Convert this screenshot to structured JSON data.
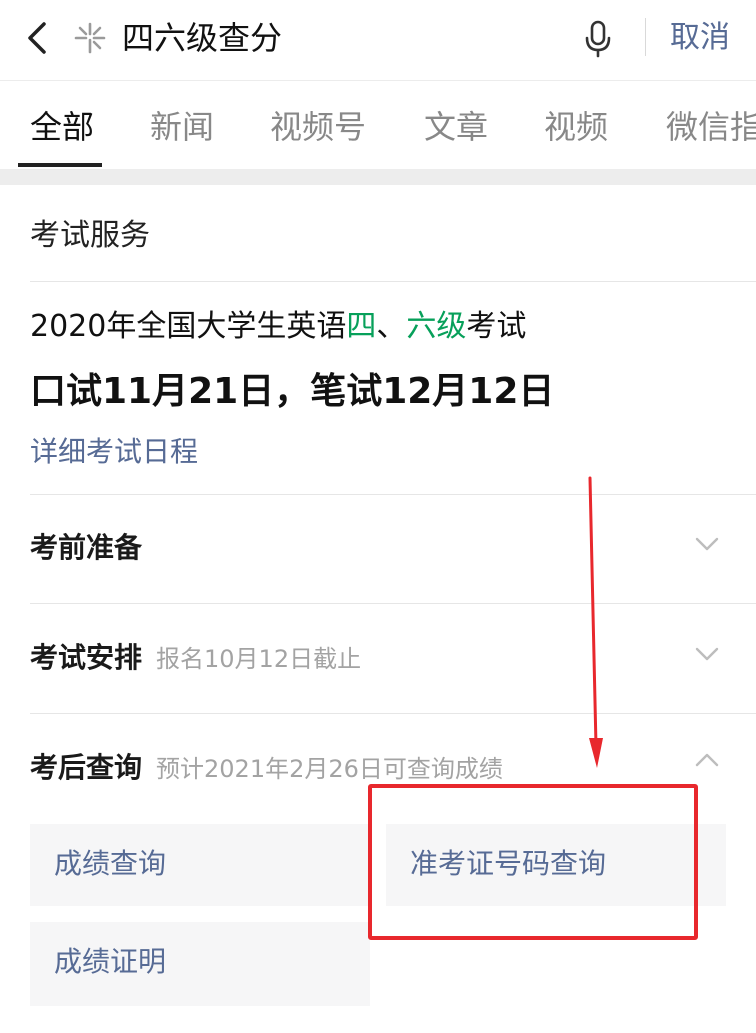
{
  "search": {
    "query": "四六级查分",
    "cancel_label": "取消",
    "icons": [
      "back-arrow-icon",
      "sparkle-icon",
      "microphone-icon"
    ]
  },
  "tabs": [
    "全部",
    "新闻",
    "视频号",
    "文章",
    "视频",
    "微信指"
  ],
  "active_tab": "全部",
  "card": {
    "section_title": "考试服务",
    "headline": {
      "prefix": "2020年全国大学生英语",
      "si": "四",
      "sep": "、",
      "liu": "六级",
      "suffix": "考试"
    },
    "date_line": "口试11月21日，笔试12月12日",
    "schedule_link": "详细考试日程",
    "rows": [
      {
        "title": "考前准备",
        "subtitle": ""
      },
      {
        "title": "考试安排",
        "subtitle": "报名10月12日截止"
      },
      {
        "title": "考后查询",
        "subtitle": "预计2021年2月26日可查询成绩"
      }
    ],
    "grid": [
      "成绩查询",
      "准考证号码查询",
      "成绩证明"
    ]
  },
  "colors": {
    "link": "#576b95",
    "green": "#07a05a",
    "annotation_red": "#e8282d"
  }
}
